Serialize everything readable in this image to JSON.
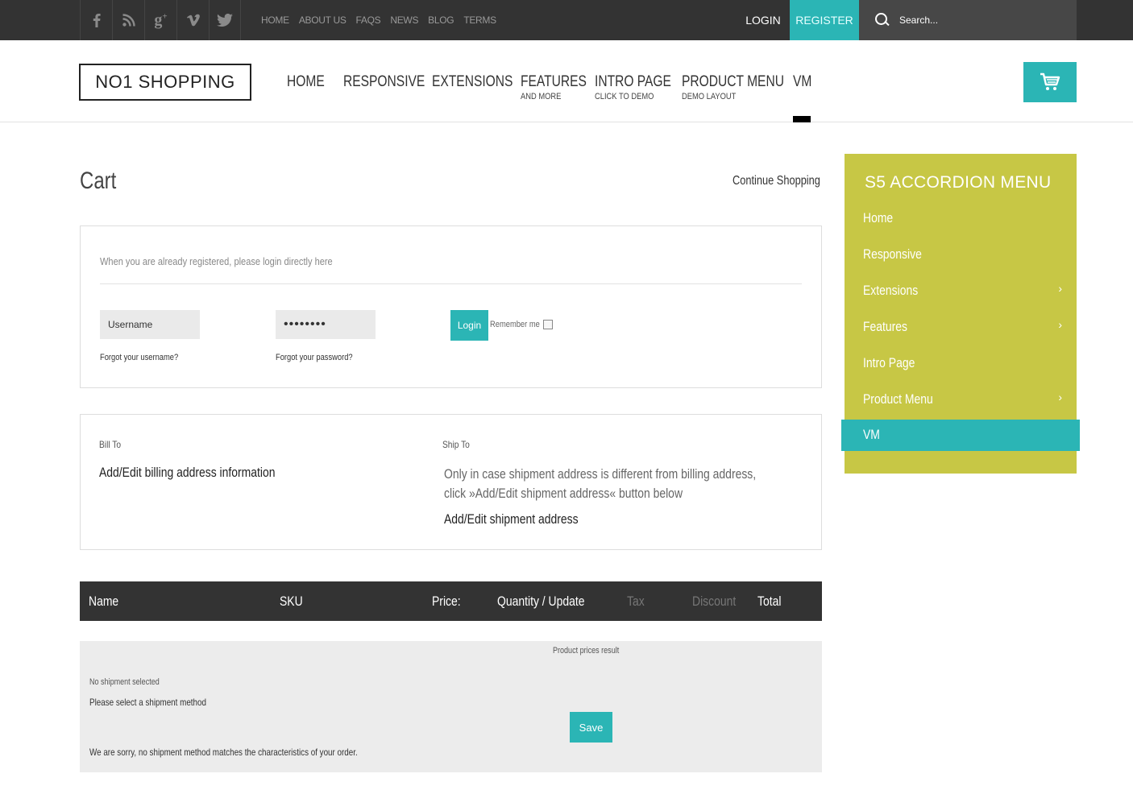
{
  "topbar": {
    "social": [
      "f",
      "rss",
      "g+",
      "v",
      "twitter"
    ],
    "links": [
      "HOME",
      "ABOUT US",
      "FAQS",
      "NEWS",
      "BLOG",
      "TERMS"
    ],
    "login": "LOGIN",
    "register": "REGISTER",
    "search_placeholder": "Search..."
  },
  "header": {
    "logo": "NO1 SHOPPING",
    "nav": [
      {
        "label": "HOME",
        "sub": ""
      },
      {
        "label": "RESPONSIVE",
        "sub": ""
      },
      {
        "label": "EXTENSIONS",
        "sub": ""
      },
      {
        "label": "FEATURES",
        "sub": "AND MORE"
      },
      {
        "label": "INTRO PAGE",
        "sub": "CLICK TO DEMO"
      },
      {
        "label": "PRODUCT MENU",
        "sub": "DEMO LAYOUT"
      },
      {
        "label": "VM",
        "sub": ""
      }
    ]
  },
  "main": {
    "title": "Cart",
    "continue": "Continue Shopping",
    "login": {
      "intro": "When you are already registered, please login directly here",
      "username_placeholder": "Username",
      "password_value": "••••••••",
      "forgot_username": "Forgot your username?",
      "forgot_password": "Forgot your password?",
      "login_button": "Login",
      "remember": "Remember me"
    },
    "address": {
      "bill_label": "Bill To",
      "bill_link": "Add/Edit billing address information",
      "ship_label": "Ship To",
      "ship_note_1": "Only in case shipment address is different from billing address,",
      "ship_note_2": "click »Add/Edit shipment address« button below",
      "ship_link": "Add/Edit shipment address"
    },
    "table_headers": [
      "Name",
      "SKU",
      "Price:",
      "Quantity / Update",
      "Tax",
      "Discount",
      "Total"
    ],
    "cart_body": {
      "prices_result": "Product prices result",
      "no_shipment": "No shipment selected",
      "select_shipment": "Please select a shipment method",
      "save": "Save",
      "sorry": "We are sorry, no shipment method matches the characteristics of your order."
    }
  },
  "sidebar": {
    "title": "S5 ACCORDION MENU",
    "items": [
      {
        "label": "Home",
        "has_children": false
      },
      {
        "label": "Responsive",
        "has_children": false
      },
      {
        "label": "Extensions",
        "has_children": true
      },
      {
        "label": "Features",
        "has_children": true
      },
      {
        "label": "Intro Page",
        "has_children": false
      },
      {
        "label": "Product Menu",
        "has_children": true
      },
      {
        "label": "VM",
        "has_children": false
      }
    ],
    "active": "VM"
  },
  "colors": {
    "accent": "#2bb5b5",
    "sidebar": "#c7c745",
    "topbar": "#333333"
  }
}
